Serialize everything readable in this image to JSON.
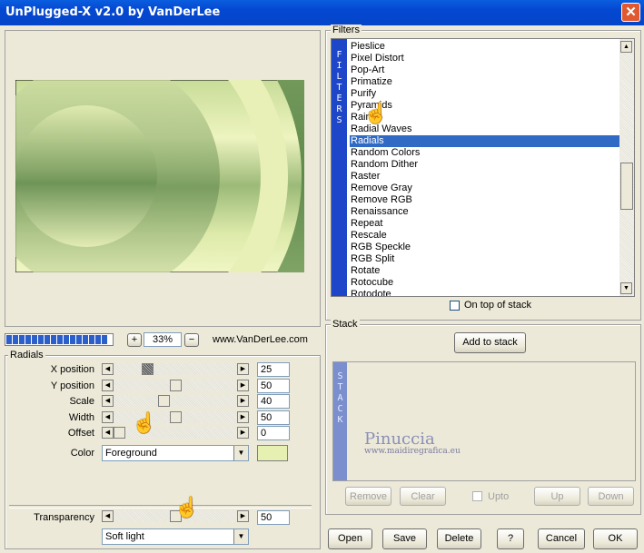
{
  "window": {
    "title": "UnPlugged-X v2.0 by VanDerLee",
    "close_symbol": "✕"
  },
  "preview": {
    "zoom": "33%",
    "zoom_minus": "−",
    "zoom_plus": "+",
    "url": "www.VanDerLee.com",
    "progress_blocks": 16
  },
  "radials": {
    "group_label": "Radials",
    "params": [
      {
        "label": "X position",
        "value": "25",
        "level": 0.25
      },
      {
        "label": "Y position",
        "value": "50",
        "level": 0.5
      },
      {
        "label": "Scale",
        "value": "40",
        "level": 0.4
      },
      {
        "label": "Width",
        "value": "50",
        "level": 0.5
      },
      {
        "label": "Offset",
        "value": "0",
        "level": 0.0
      }
    ],
    "color_label": "Color",
    "color_value": "Foreground",
    "color_swatch": "#e6f0b0",
    "transparency_label": "Transparency",
    "transparency_value": "50",
    "transparency_level": 0.5,
    "blend_mode": "Soft light"
  },
  "filters": {
    "group_label": "Filters",
    "strip_letters": [
      "F",
      "I",
      "L",
      "T",
      "E",
      "R",
      "S"
    ],
    "items": [
      "Pieslice",
      "Pixel Distort",
      "Pop-Art",
      "Primatize",
      "Purify",
      "Pyramids",
      "Rain",
      "Radial Waves",
      "Radials",
      "Random Colors",
      "Random Dither",
      "Raster",
      "Remove Gray",
      "Remove RGB",
      "Renaissance",
      "Repeat",
      "Rescale",
      "RGB Speckle",
      "RGB Split",
      "Rotate",
      "Rotocube",
      "Rotodote"
    ],
    "selected": "Radials",
    "on_top_label": "On top of stack"
  },
  "stack": {
    "group_label": "Stack",
    "add_label": "Add to stack",
    "strip_letters": [
      "S",
      "T",
      "A",
      "C",
      "K"
    ],
    "remove_label": "Remove",
    "clear_label": "Clear",
    "upto_label": "Upto",
    "up_label": "Up",
    "down_label": "Down"
  },
  "watermark": {
    "name": "Pinuccia",
    "site": "www.maidiregrafica.eu"
  },
  "footer": {
    "open": "Open",
    "save": "Save",
    "delete": "Delete",
    "help": "?",
    "cancel": "Cancel",
    "ok": "OK"
  },
  "colors": {
    "accent": "#1d47c8",
    "selection": "#316ac5",
    "titlebar": "#0447d1"
  }
}
